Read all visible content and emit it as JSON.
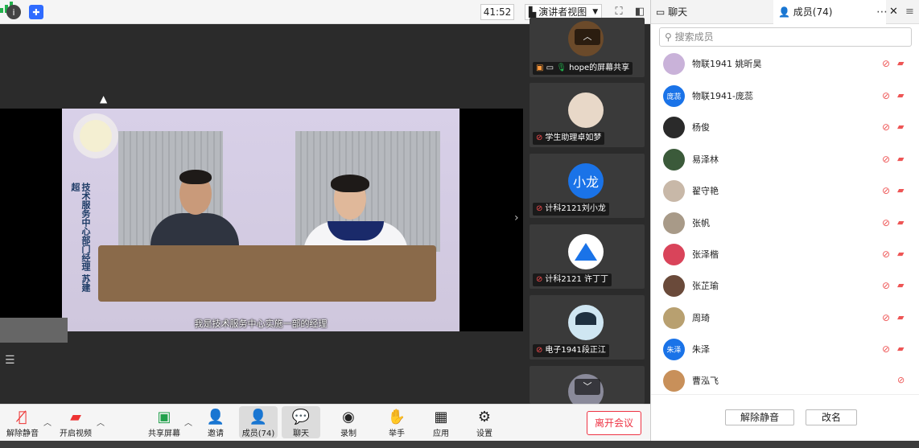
{
  "topbar": {
    "timer": "41:52",
    "view_mode": "演讲者视图",
    "icons": [
      "info-icon",
      "shield-icon",
      "signal-icon",
      "fullscreen-icon",
      "panel-toggle-icon"
    ]
  },
  "video": {
    "caption_vertical": "技术服务中心部门经理 苏建超",
    "subtitle": "我是技术服务中心实施一部的经理"
  },
  "thumbnails": [
    {
      "label": "hope的屏幕共享",
      "avatar_text": "",
      "avatar_color": "#555555"
    },
    {
      "label": "学生助理卓如梦",
      "avatar_text": "",
      "avatar_color": "#e8d8c8"
    },
    {
      "label": "计科2121刘小龙",
      "avatar_text": "小龙",
      "avatar_color": "#1a73e8"
    },
    {
      "label": "计科2121 许丁丁",
      "avatar_text": "",
      "avatar_color": "#ffffff"
    },
    {
      "label": "电子1941段正江",
      "avatar_text": "",
      "avatar_color": "#cfe6f2"
    }
  ],
  "toolbar": {
    "unmute": "解除静音",
    "start_video": "开启视频",
    "share_screen": "共享屏幕",
    "invite": "邀请",
    "members": "成员(74)",
    "chat": "聊天",
    "record": "录制",
    "raise_hand": "举手",
    "apps": "应用",
    "settings": "设置",
    "leave": "离开会议"
  },
  "panel": {
    "tab_chat": "聊天",
    "tab_members": "成员(74)",
    "search_placeholder": "搜索成员",
    "members": [
      {
        "name": "物联1941 姚昕昊",
        "avatar_text": "",
        "avatar_color": "#c9b2d9"
      },
      {
        "name": "物联1941-庞蕊",
        "avatar_text": "庞蕊",
        "avatar_color": "#1a73e8"
      },
      {
        "name": "杨俊",
        "avatar_text": "",
        "avatar_color": "#2a2a2a"
      },
      {
        "name": "易泽林",
        "avatar_text": "",
        "avatar_color": "#3b5a3a"
      },
      {
        "name": "翟守艳",
        "avatar_text": "",
        "avatar_color": "#c8b8a8"
      },
      {
        "name": "张帆",
        "avatar_text": "",
        "avatar_color": "#a89a88"
      },
      {
        "name": "张泽楷",
        "avatar_text": "",
        "avatar_color": "#d9445a"
      },
      {
        "name": "张芷瑜",
        "avatar_text": "",
        "avatar_color": "#6a4a3a"
      },
      {
        "name": "周琦",
        "avatar_text": "",
        "avatar_color": "#b8a070"
      },
      {
        "name": "朱泽",
        "avatar_text": "朱泽",
        "avatar_color": "#1a73e8"
      },
      {
        "name": "曹泓飞",
        "avatar_text": "",
        "avatar_color": "#c8905a"
      }
    ],
    "footer_unmute": "解除静音",
    "footer_rename": "改名"
  },
  "colors": {
    "accent_blue": "#1a73e8",
    "leave_red": "#ee3344",
    "muted_red": "#ee5555"
  }
}
